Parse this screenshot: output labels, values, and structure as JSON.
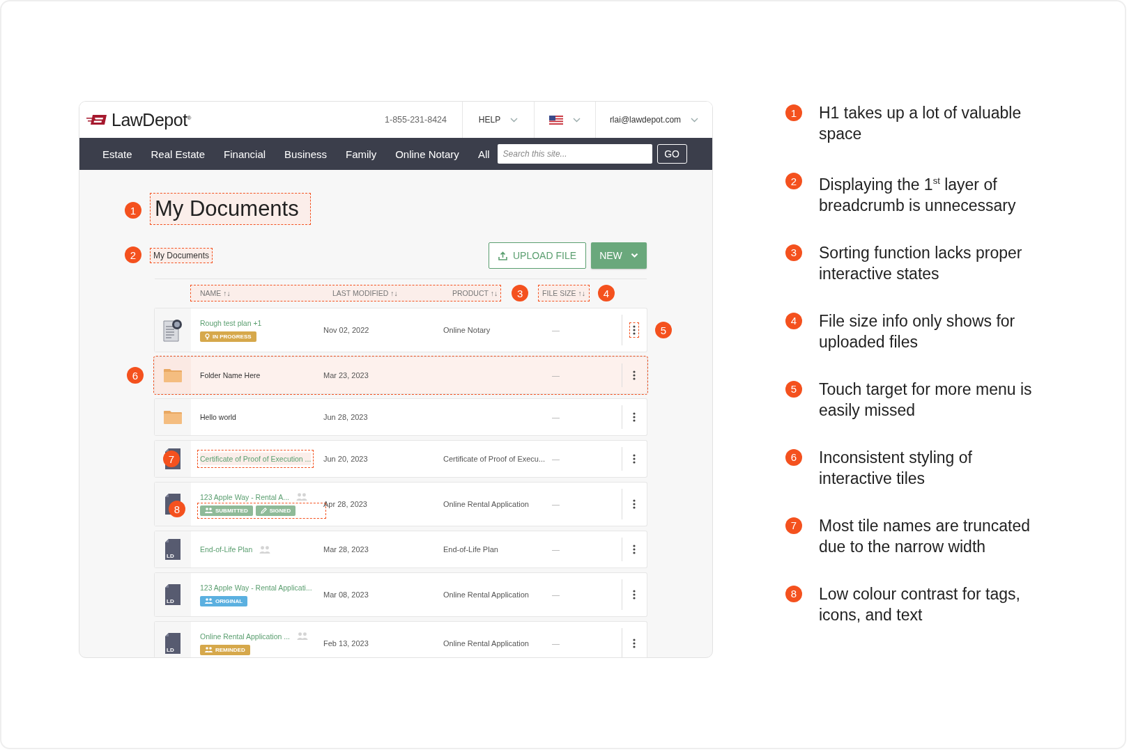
{
  "header": {
    "logo": "LawDepot$^{®}$",
    "phone": "1-855-231-8424",
    "help": "HELP",
    "account": "rlai@lawdepot.com"
  },
  "nav": {
    "items": [
      "Estate",
      "Real Estate",
      "Financial",
      "Business",
      "Family",
      "Online Notary",
      "All"
    ],
    "search": {
      "placeholder": "Search this site..."
    },
    "go": "GO"
  },
  "page": {
    "title": "My Documents",
    "title_marker": "1",
    "breadcrumb": "My Documents",
    "breadcrumb_marker": "2",
    "upload_button": "UPLOAD FILE",
    "new_button": "NEW"
  },
  "table": {
    "columns": [
      {
        "label": "NAME",
        "sort": "↑↓"
      },
      {
        "label": "LAST MODIFIED",
        "sort": "↑↓"
      },
      {
        "label": "PRODUCT",
        "sort": "↑↓"
      },
      {
        "label": "FILE SIZE",
        "sort": "↑↓"
      }
    ],
    "sort_marker": "3",
    "size_marker": "4",
    "rows": [
      {
        "kind": "notary",
        "name": "Rough test plan +1",
        "date": "Nov 02, 2022",
        "product": "Online Notary",
        "size": "—",
        "shared": false,
        "highlighted": false,
        "menu_marker": "5",
        "tags": [
          {
            "kind": "bulb",
            "label": "IN PROGRESS",
            "color": "#d6a84b"
          }
        ]
      },
      {
        "kind": "folder",
        "name": "Folder Name Here",
        "date": "Mar 23, 2023",
        "size": "—",
        "shared": false,
        "highlighted": true,
        "row_marker": "6"
      },
      {
        "kind": "folder",
        "name": "Hello world",
        "date": "Jun 28, 2023",
        "size": "—",
        "shared": false,
        "highlighted": false
      },
      {
        "kind": "doc",
        "name": "Certificate of Proof of Execution ...",
        "date": "Jun 20, 2023",
        "product": "Certificate of Proof of Execu...",
        "size": "—",
        "shared": false,
        "highlighted": false,
        "name_marker": "7"
      },
      {
        "kind": "doc",
        "name": "123 Apple Way - Rental A...",
        "date": "Apr 28, 2023",
        "product": "Online Rental Application",
        "size": "—",
        "shared": true,
        "highlighted": false,
        "tags_marker": "8",
        "tags": [
          {
            "kind": "people",
            "label": "SUBMITTED",
            "color": "#8fba98"
          },
          {
            "kind": "pencil",
            "label": "SIGNED",
            "color": "#8fba98"
          }
        ]
      },
      {
        "kind": "doc",
        "icon_text": "LD",
        "name": "End-of-Life Plan",
        "date": "Mar 28, 2023",
        "product": "End-of-Life Plan",
        "size": "—",
        "shared": true,
        "highlighted": false
      },
      {
        "kind": "doc",
        "icon_text": "LD",
        "name": "123 Apple Way - Rental Applicati...",
        "date": "Mar 08, 2023",
        "product": "Online Rental Application",
        "size": "—",
        "shared": false,
        "highlighted": false,
        "tags": [
          {
            "kind": "people",
            "label": "ORIGINAL",
            "color": "#5bb0e0"
          }
        ]
      },
      {
        "kind": "doc",
        "icon_text": "LD",
        "name": "Online Rental Application ...",
        "date": "Feb 13, 2023",
        "product": "Online Rental Application",
        "size": "—",
        "shared": true,
        "highlighted": false,
        "tags": [
          {
            "kind": "people",
            "label": "REMINDED",
            "color": "#d6a84b"
          }
        ]
      }
    ]
  },
  "notes": [
    {
      "number": "1",
      "text": "H1 takes up a lot of valuable space"
    },
    {
      "number": "2",
      "text": "Displaying the 1$^{st}$ layer of breadcrumb is unnecessary"
    },
    {
      "number": "3",
      "text": "Sorting function lacks proper interactive states"
    },
    {
      "number": "4",
      "text": "File size info only shows for uploaded files"
    },
    {
      "number": "5",
      "text": "Touch target for more menu is easily missed"
    },
    {
      "number": "6",
      "text": "Inconsistent styling of interactive tiles"
    },
    {
      "number": "7",
      "text": "Most tile names are truncated due to the narrow width"
    },
    {
      "number": "8",
      "text": "Low colour contrast for tags, icons, and text"
    }
  ]
}
